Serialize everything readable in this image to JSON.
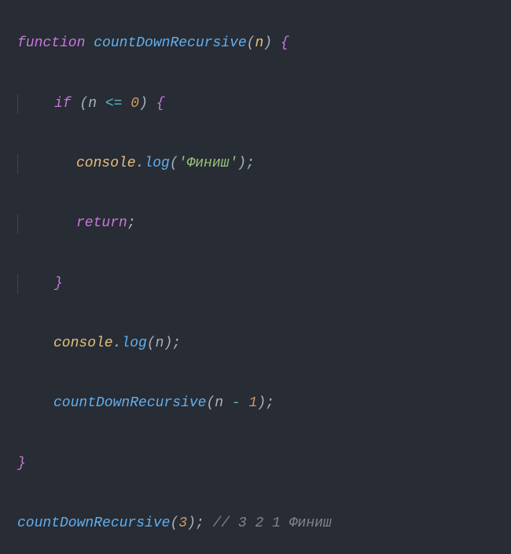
{
  "tokens": {
    "kw_function": "function",
    "fn_name": "countDownRecursive",
    "param_n": "n",
    "kw_if": "if",
    "op_lte": "<=",
    "num_zero": "0",
    "obj_console": "console",
    "method_log": "log",
    "str_finish": "'Финиш'",
    "kw_return": "return",
    "num_one": "1",
    "op_minus": "-",
    "call_arg": "3",
    "comment": "// 3 2 1 Финиш",
    "lparen": "(",
    "rparen": ")",
    "lbrace": "{",
    "rbrace": "}",
    "dot": ".",
    "semi": ";",
    "space": " "
  }
}
